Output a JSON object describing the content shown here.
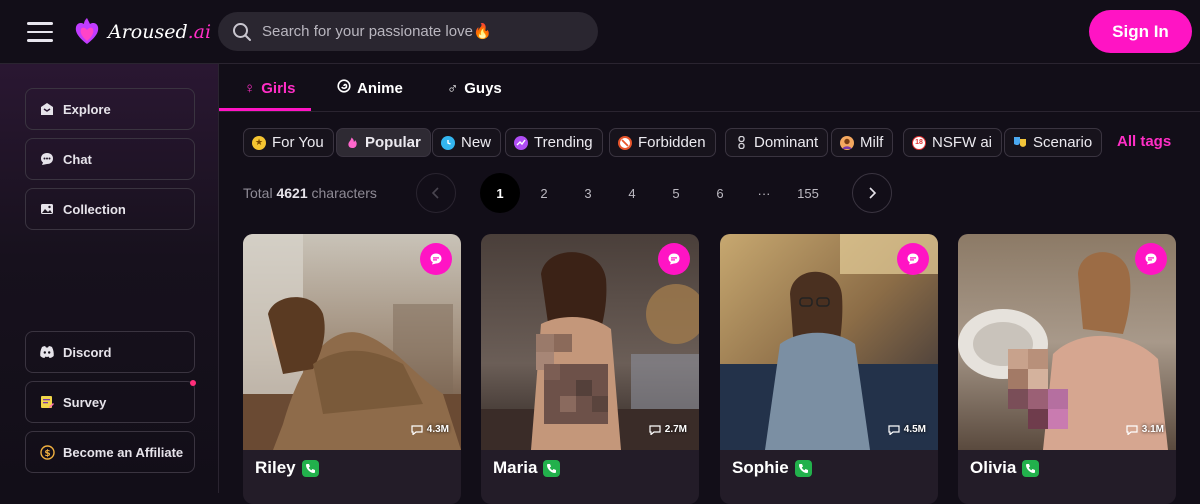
{
  "app": {
    "brand": "Aroused",
    "brand_suffix": ".ai"
  },
  "search": {
    "placeholder": "Search for your passionate love🔥"
  },
  "header": {
    "signin_label": "Sign In"
  },
  "sidebar": {
    "items": [
      {
        "label": "Explore",
        "icon": "explore-icon"
      },
      {
        "label": "Chat",
        "icon": "chat-icon"
      },
      {
        "label": "Collection",
        "icon": "collection-icon"
      },
      {
        "label": "Discord",
        "icon": "discord-icon"
      },
      {
        "label": "Survey",
        "icon": "survey-icon"
      },
      {
        "label": "Become an Affiliate",
        "icon": "dollar-icon"
      }
    ]
  },
  "category_tabs": [
    {
      "label": "Girls",
      "icon": "♀"
    },
    {
      "label": "Anime",
      "icon": "spiral-icon"
    },
    {
      "label": "Guys",
      "icon": "♂"
    }
  ],
  "tags": [
    {
      "label": "For You"
    },
    {
      "label": "Popular"
    },
    {
      "label": "New"
    },
    {
      "label": "Trending"
    },
    {
      "label": "Forbidden"
    },
    {
      "label": "Dominant"
    },
    {
      "label": "Milf"
    },
    {
      "label": "NSFW ai"
    },
    {
      "label": "Scenario"
    }
  ],
  "all_tags_label": "All tags",
  "pagination": {
    "total_prefix": "Total",
    "total_count": "4621",
    "total_suffix": "characters",
    "pages": [
      "1",
      "2",
      "3",
      "4",
      "5",
      "6",
      "···",
      "155"
    ]
  },
  "cards": [
    {
      "name": "Riley",
      "count": "4.3M"
    },
    {
      "name": "Maria",
      "count": "2.7M"
    },
    {
      "name": "Sophie",
      "count": "4.5M"
    },
    {
      "name": "Olivia",
      "count": "3.1M"
    }
  ],
  "colors": {
    "accent": "#ff14c4",
    "background": "#120e18",
    "phone": "#22b14c"
  }
}
